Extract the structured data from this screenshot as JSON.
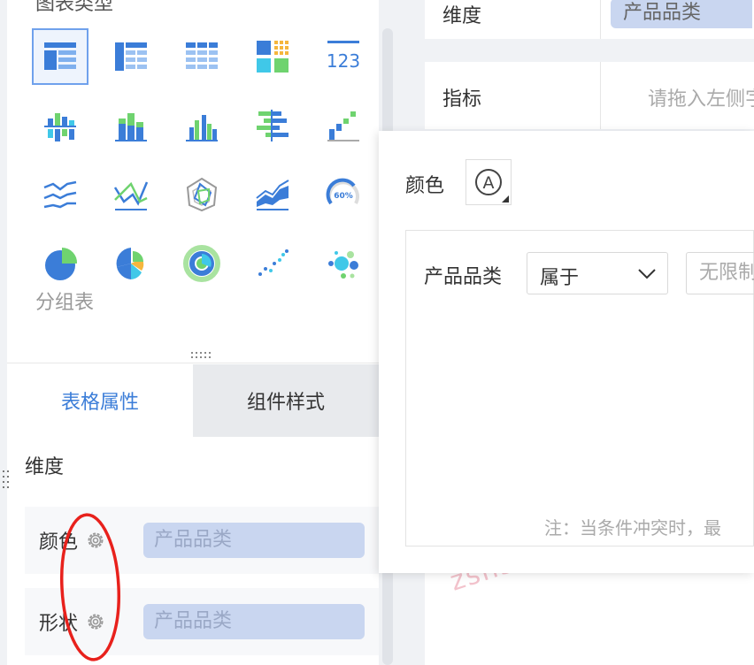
{
  "left_panel": {
    "section_title": "图表类型",
    "chart_type_name": "分组表",
    "tabs": [
      {
        "label": "表格属性",
        "active": true
      },
      {
        "label": "组件样式",
        "active": false
      }
    ],
    "dimension_label": "维度",
    "rows": [
      {
        "label": "颜色",
        "field": "产品品类"
      },
      {
        "label": "形状",
        "field": "产品品类"
      }
    ],
    "chart_icons": [
      "grouped-table-icon",
      "cross-table-icon",
      "detail-table-icon",
      "color-block-icon",
      "kpi-number-icon",
      "stacked-column-icon",
      "grouped-column-icon",
      "multi-column-icon",
      "bar-icon",
      "waterfall-icon",
      "line-icon",
      "line-combo-icon",
      "radar-icon",
      "area-icon",
      "gauge-icon",
      "pie-icon",
      "rose-pie-icon",
      "donut-icon",
      "scatter-icon",
      "bubble-icon"
    ],
    "gauge_text": "60%",
    "kpi_text": "123"
  },
  "right_panel": {
    "dimension_label": "维度",
    "dimension_field": "产品品类",
    "metric_label": "指标",
    "metric_placeholder": "请拖入左侧字段"
  },
  "popup": {
    "color_label": "颜色",
    "auto_color_glyph": "A",
    "condition": {
      "field": "产品品类",
      "operator": "属于",
      "value_placeholder": "无限制",
      "note": "注：当条件冲突时，最"
    }
  },
  "watermark": "zshs",
  "colors": {
    "accent": "#3b7dd8",
    "pill": "#c9d6f0",
    "annotation": "#e8211c"
  }
}
